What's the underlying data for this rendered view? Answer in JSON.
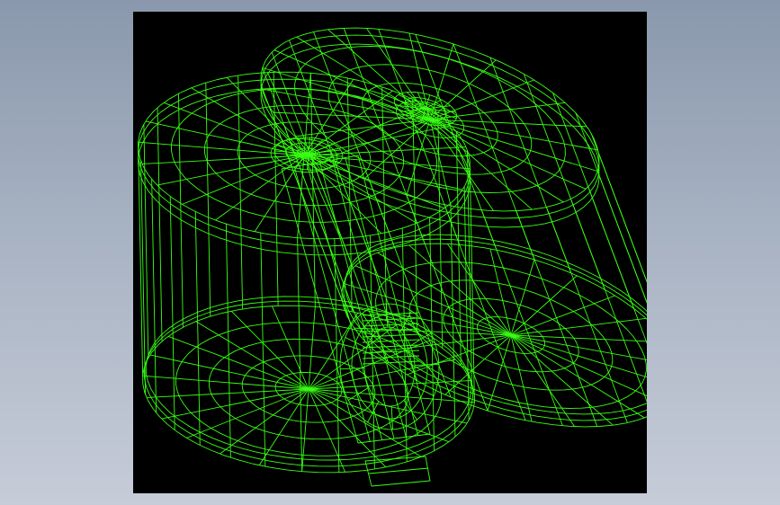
{
  "colors": {
    "background_top": "#8a98ad",
    "background_bottom": "#c6ccd8",
    "viewport": "#000000",
    "wireframe": "#39ff14"
  },
  "scene": {
    "object": "wireframe-model",
    "render_mode": "wireframe"
  }
}
